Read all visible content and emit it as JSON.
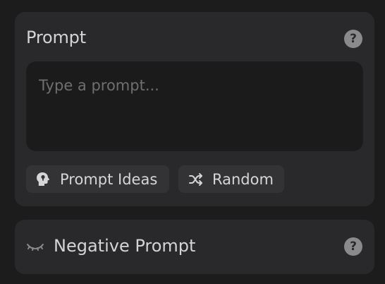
{
  "prompt": {
    "title": "Prompt",
    "help_icon": "question-icon",
    "placeholder": "Type a prompt...",
    "value": "",
    "buttons": {
      "ideas": {
        "label": "Prompt Ideas",
        "icon": "head-lightbulb-icon"
      },
      "random": {
        "label": "Random",
        "icon": "shuffle-icon"
      }
    }
  },
  "negative_prompt": {
    "title": "Negative Prompt",
    "icon": "eye-closed-icon",
    "help_icon": "question-icon"
  },
  "colors": {
    "background": "#1c1c1d",
    "card": "#29292b",
    "input": "#1b1b1c",
    "chip": "#333335",
    "text": "#d4d4d6",
    "muted": "#8a8a8d"
  }
}
